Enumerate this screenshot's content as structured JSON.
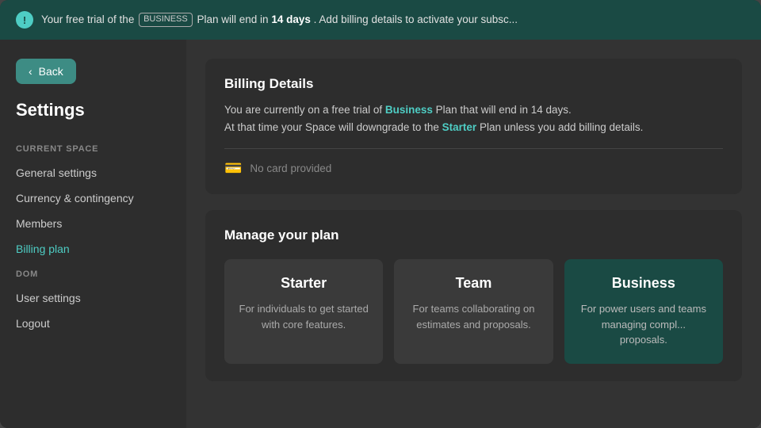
{
  "banner": {
    "icon": "!",
    "text_before": "Your free trial of the",
    "business_badge": "BUSINESS",
    "text_middle": "Plan will end in",
    "days_bold": "14 days",
    "text_after": ". Add billing details to activate your subsc..."
  },
  "sidebar": {
    "back_label": "Back",
    "title": "Settings",
    "section_current_space": "CURRENT SPACE",
    "items_current_space": [
      {
        "label": "General settings",
        "active": false,
        "key": "general-settings"
      },
      {
        "label": "Currency & contingency",
        "active": false,
        "key": "currency-contingency"
      },
      {
        "label": "Members",
        "active": false,
        "key": "members"
      },
      {
        "label": "Billing plan",
        "active": true,
        "key": "billing-plan"
      }
    ],
    "section_dom": "DOM",
    "items_dom": [
      {
        "label": "User settings",
        "active": false,
        "key": "user-settings"
      },
      {
        "label": "Logout",
        "active": false,
        "key": "logout"
      }
    ]
  },
  "billing_details": {
    "title": "Billing Details",
    "text_line1_before": "You are currently on a free trial of ",
    "business_link": "Business",
    "text_line1_after": " Plan that will end in 14 days.",
    "text_line2_before": "At that time your Space will downgrade to the ",
    "starter_link": "Starter",
    "text_line2_after": " Plan unless you add billing details.",
    "card_text": "No card provided"
  },
  "manage_plan": {
    "title": "Manage your plan",
    "plans": [
      {
        "name": "Starter",
        "description": "For individuals to get started with core features.",
        "active": false
      },
      {
        "name": "Team",
        "description": "For teams collaborating on estimates and proposals.",
        "active": false
      },
      {
        "name": "Business",
        "description": "For power users and teams managing compl... proposals.",
        "active": true
      }
    ]
  }
}
